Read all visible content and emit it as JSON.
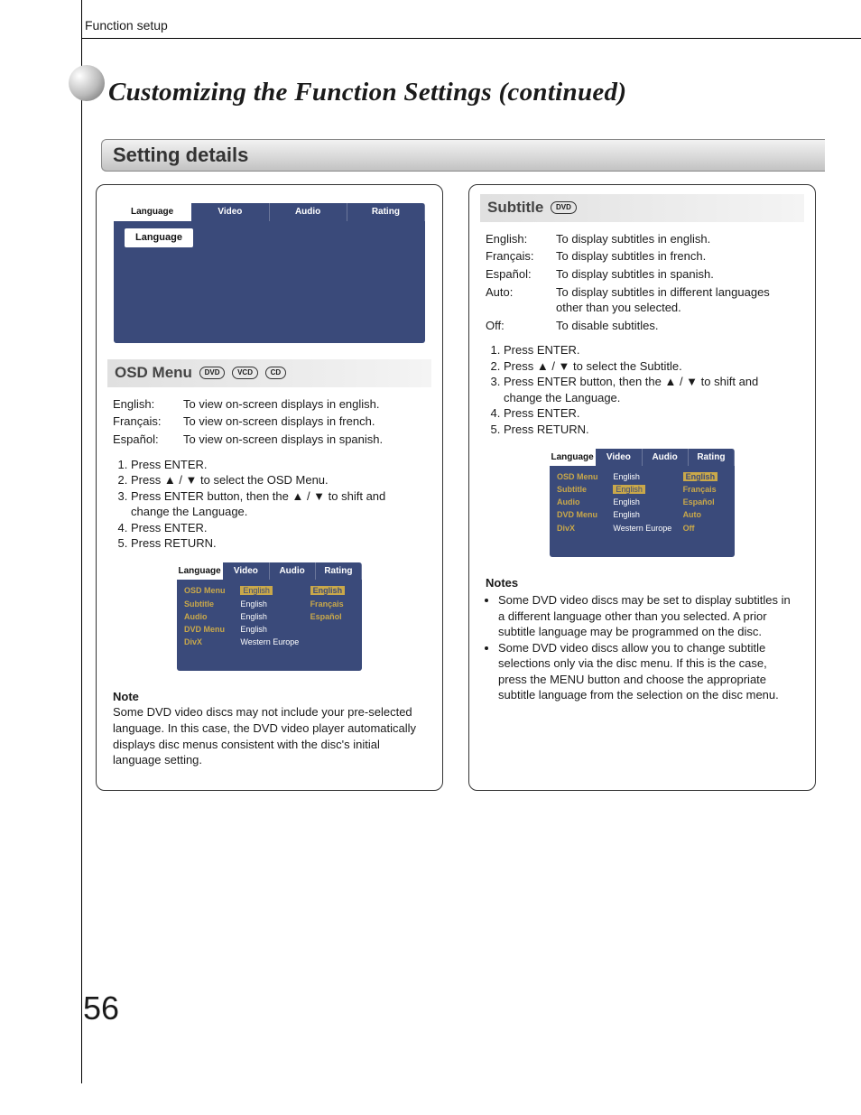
{
  "header": {
    "section": "Function setup"
  },
  "title": "Customizing the Function Settings (continued)",
  "setting_details_heading": "Setting details",
  "page_number": "56",
  "tabs": {
    "language": "Language",
    "video": "Video",
    "audio": "Audio",
    "rating": "Rating"
  },
  "language_pill": "Language",
  "menu_items": {
    "osd": {
      "label": "OSD Menu",
      "value": "English"
    },
    "sub": {
      "label": "Subtitle",
      "value": "English"
    },
    "aud": {
      "label": "Audio",
      "value": "English"
    },
    "dvd": {
      "label": "DVD Menu",
      "value": "English"
    },
    "divx": {
      "label": "DivX",
      "value": "Western Europe"
    }
  },
  "osd_options": {
    "o1": "English",
    "o2": "Français",
    "o3": "Español"
  },
  "subtitle_options": {
    "o1": "English",
    "o2": "Français",
    "o3": "Español",
    "o4": "Auto",
    "o5": "Off"
  },
  "osd": {
    "heading": "OSD Menu",
    "badges": {
      "b1": "DVD",
      "b2": "VCD",
      "b3": "CD"
    },
    "defs": {
      "k1": "English:",
      "v1": "To view on-screen displays in english.",
      "k2": "Français:",
      "v2": "To view on-screen displays in french.",
      "k3": "Español:",
      "v3": "To view on-screen displays in spanish."
    },
    "steps": {
      "s1": "Press ENTER.",
      "s2": "Press ▲ / ▼ to select the OSD Menu.",
      "s3": "Press ENTER button, then the ▲ / ▼ to shift and change the Language.",
      "s4": "Press ENTER.",
      "s5": "Press RETURN."
    },
    "note_h": "Note",
    "note": "Some DVD video discs may not include your pre-selected language. In this case, the DVD video player automatically displays disc menus consistent with the disc's initial language setting."
  },
  "subtitle": {
    "heading": "Subtitle",
    "badges": {
      "b1": "DVD"
    },
    "defs": {
      "k1": "English:",
      "v1": "To display subtitles in english.",
      "k2": "Français:",
      "v2": "To display subtitles in french.",
      "k3": "Español:",
      "v3": "To display subtitles in spanish.",
      "k4": "Auto:",
      "v4": "To display subtitles in different languages other than you selected.",
      "k5": "Off:",
      "v5": "To disable subtitles."
    },
    "steps": {
      "s1": "Press ENTER.",
      "s2": "Press ▲ / ▼ to select the Subtitle.",
      "s3": "Press ENTER button, then the ▲ / ▼ to shift and change the Language.",
      "s4": "Press ENTER.",
      "s5": "Press RETURN."
    },
    "notes_h": "Notes",
    "notes": {
      "n1": "Some DVD video discs may be set to display subtitles in a different language other than you selected. A prior subtitle language may be programmed on the disc.",
      "n2": "Some DVD video discs allow you to change subtitle selections only via the disc menu. If this is the case, press the MENU button and choose the appropriate subtitle language from the selection on the disc menu."
    }
  }
}
